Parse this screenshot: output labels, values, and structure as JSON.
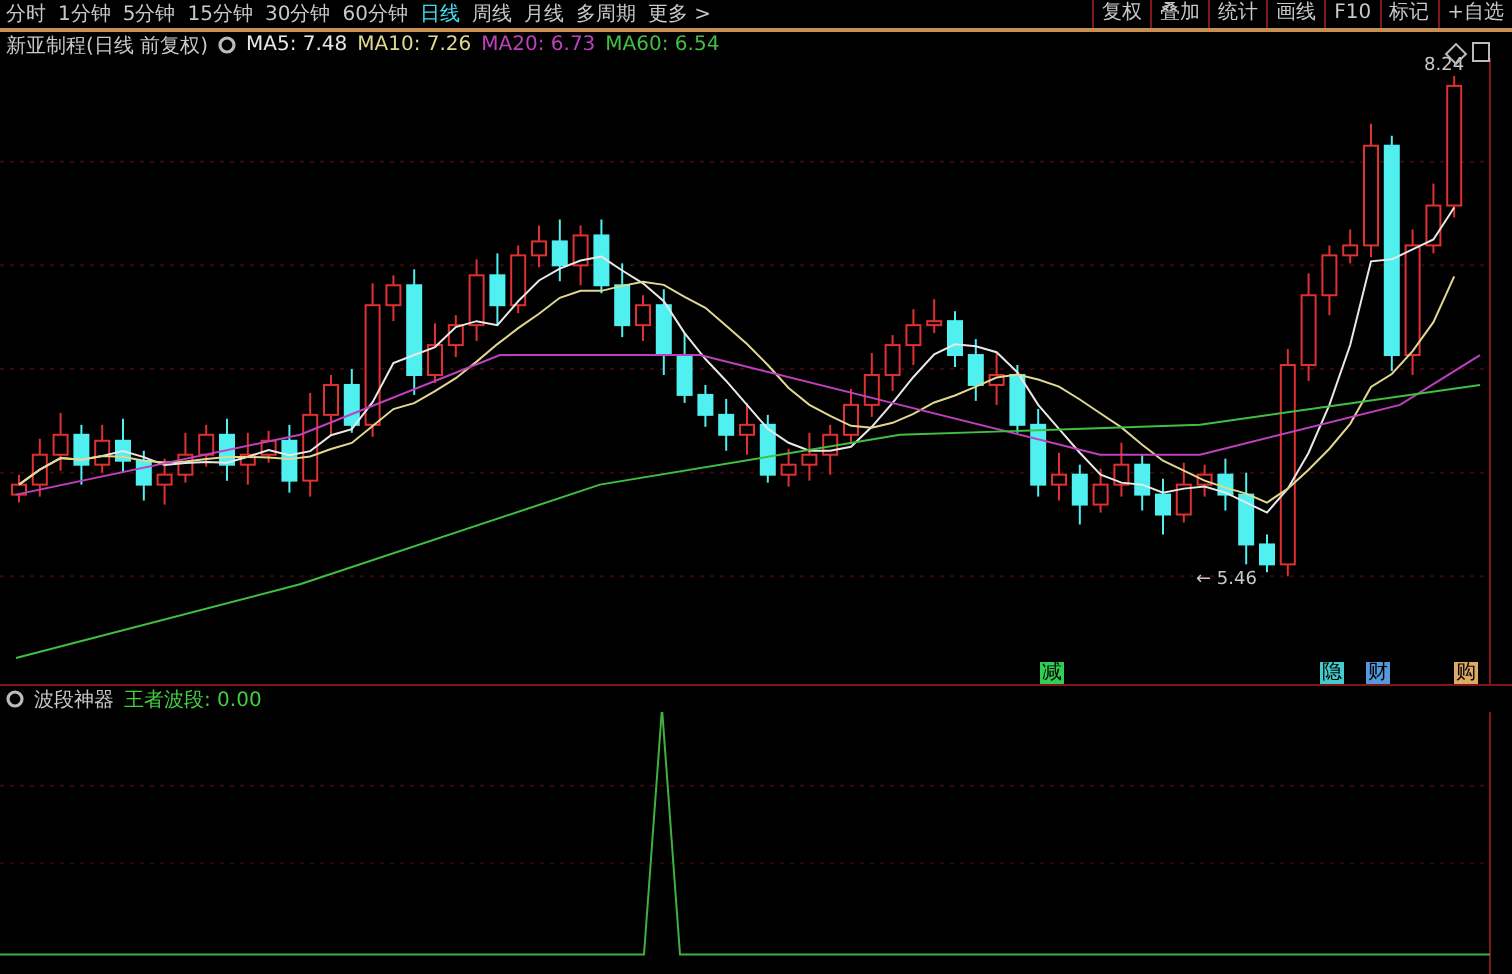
{
  "toolbar": {
    "periods": [
      {
        "label": "分时",
        "selected": false
      },
      {
        "label": "1分钟",
        "selected": false
      },
      {
        "label": "5分钟",
        "selected": false
      },
      {
        "label": "15分钟",
        "selected": false
      },
      {
        "label": "30分钟",
        "selected": false
      },
      {
        "label": "60分钟",
        "selected": false
      },
      {
        "label": "日线",
        "selected": true
      },
      {
        "label": "周线",
        "selected": false
      },
      {
        "label": "月线",
        "selected": false
      },
      {
        "label": "多周期",
        "selected": false
      },
      {
        "label": "更多 >",
        "selected": false
      }
    ],
    "buttons": [
      "复权",
      "叠加",
      "统计",
      "画线",
      "F10",
      "标记",
      "+自选"
    ]
  },
  "price_chart": {
    "title": "新亚制程(日线 前复权)",
    "indicators": [
      {
        "label": "MA5: 7.48",
        "color": "#e8e8e8"
      },
      {
        "label": "MA10: 7.26",
        "color": "#e0d890"
      },
      {
        "label": "MA20: 6.73",
        "color": "#c040c0"
      },
      {
        "label": "MA60: 6.54",
        "color": "#40c040"
      }
    ],
    "high_label": "8.24",
    "low_label": "← 5.46",
    "signals": [
      {
        "label": "减",
        "color": "#33cc55"
      },
      {
        "label": "隐",
        "color": "#44cccc"
      },
      {
        "label": "财",
        "color": "#5599dd"
      },
      {
        "label": "购",
        "color": "#ddaa66"
      }
    ]
  },
  "indicator_pane": {
    "title": "波段神器",
    "value": "王者波段: 0.00"
  }
}
